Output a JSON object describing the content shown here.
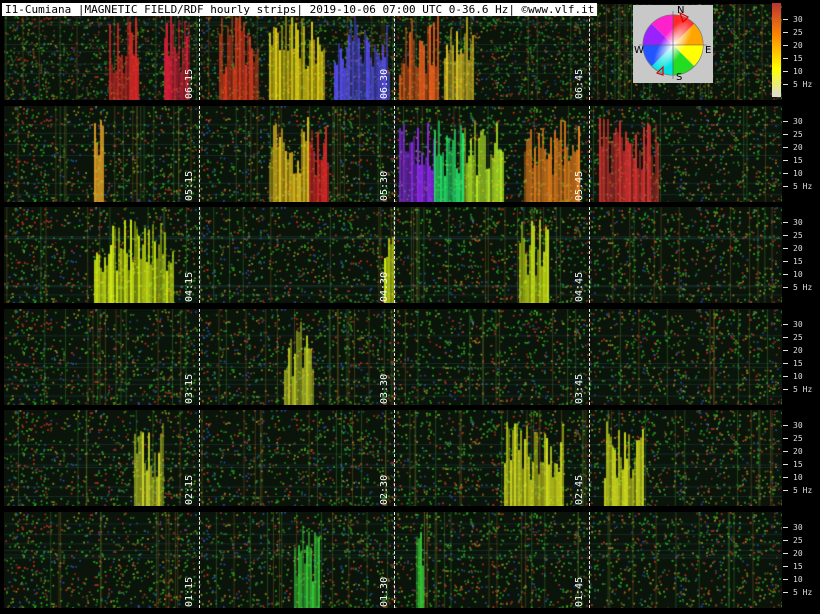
{
  "title": "I1-Cumiana |MAGNETIC FIELD/RDF hourly strips| 2019-10-06 07:00 UTC 0-36.6 Hz| ©www.vlf.it",
  "compass": {
    "north": "N",
    "east": "E",
    "south": "S",
    "west": "W"
  },
  "chart_data": {
    "type": "heatmap",
    "frequency_range_hz": [
      0,
      36.6
    ],
    "y_ticks": [
      "30",
      "25",
      "20",
      "15",
      "10",
      "5 Hz"
    ],
    "strips": [
      {
        "hour": "06",
        "time_labels": [
          "06:15",
          "06:30",
          "06:45"
        ]
      },
      {
        "hour": "05",
        "time_labels": [
          "05:15",
          "05:30",
          "05:45"
        ]
      },
      {
        "hour": "04",
        "time_labels": [
          "04:15",
          "04:30",
          "04:45"
        ]
      },
      {
        "hour": "03",
        "time_labels": [
          "03:15",
          "03:30",
          "03:45"
        ]
      },
      {
        "hour": "02",
        "time_labels": [
          "02:15",
          "02:30",
          "02:45"
        ]
      },
      {
        "hour": "01",
        "time_labels": [
          "01:15",
          "01:30",
          "01:45"
        ]
      }
    ]
  }
}
